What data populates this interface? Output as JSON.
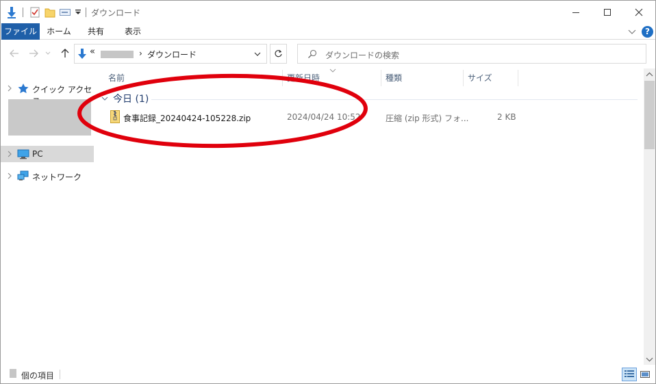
{
  "titlebar": {
    "title": "ダウンロード",
    "icons": [
      "download-arrow-icon",
      "properties-check-icon",
      "new-folder-icon",
      "rename-icon",
      "customize-dropdown-icon"
    ],
    "buttons": [
      "minimize-icon",
      "maximize-icon",
      "close-icon"
    ]
  },
  "ribbon": {
    "tabs": [
      "ファイル",
      "ホーム",
      "共有",
      "表示"
    ],
    "help_label": "?",
    "accent": "#1f5fa8"
  },
  "nav": {
    "address": {
      "overflow": "«",
      "current": "ダウンロード"
    },
    "search_placeholder": "ダウンロードの検索"
  },
  "navpane": {
    "items": [
      {
        "label": "クイック アクセス",
        "icon": "star-icon"
      },
      {
        "label": "PC",
        "icon": "pc-icon",
        "selected": true
      },
      {
        "label": "ネットワーク",
        "icon": "network-icon"
      }
    ]
  },
  "content": {
    "columns": [
      "名前",
      "更新日時",
      "種類",
      "サイズ"
    ],
    "group": {
      "label": "今日 (1)"
    },
    "rows": [
      {
        "name": "食事記録_20240424-105228.zip",
        "modified": "2024/04/24 10:52",
        "type": "圧縮 (zip 形式) フォ...",
        "size": "2 KB",
        "icon": "zip-folder-icon"
      }
    ]
  },
  "status": {
    "count": "個の項目",
    "views": [
      "details-view-icon",
      "large-icons-view-icon"
    ]
  },
  "annotation": {
    "shape": "ellipse",
    "color": "#e0000c"
  }
}
